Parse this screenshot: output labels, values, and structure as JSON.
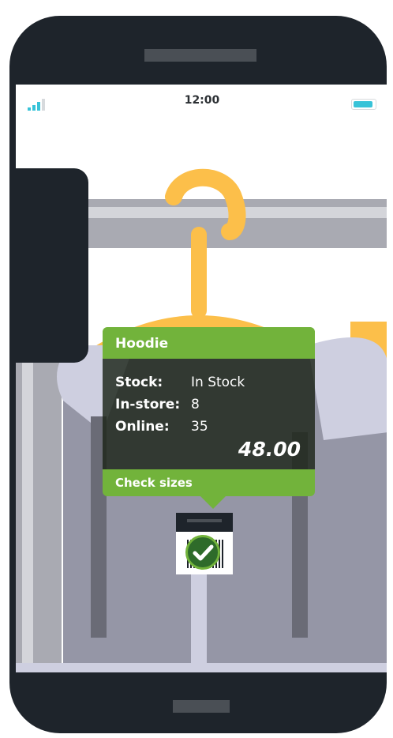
{
  "status_bar": {
    "time": "12:00",
    "signal_icon": "signal-bars-icon",
    "battery_icon": "battery-icon"
  },
  "product_popup": {
    "title": "Hoodie",
    "rows": [
      {
        "label": "Stock:",
        "value": "In Stock"
      },
      {
        "label": "In-store:",
        "value": "8"
      },
      {
        "label": "Online:",
        "value": "35"
      }
    ],
    "price": "48.00",
    "action_label": "Check sizes"
  },
  "scan_marker": {
    "icon": "check-circle-icon",
    "barcode_icon": "barcode-icon"
  },
  "colors": {
    "phone_body": "#1e242b",
    "popup_green": "#72b33b",
    "popup_body": "#1c2418",
    "hanger": "#fcbf4a",
    "hoodie": "#9596a6",
    "rail": "#a9aab2",
    "battery": "#38c3d8"
  }
}
